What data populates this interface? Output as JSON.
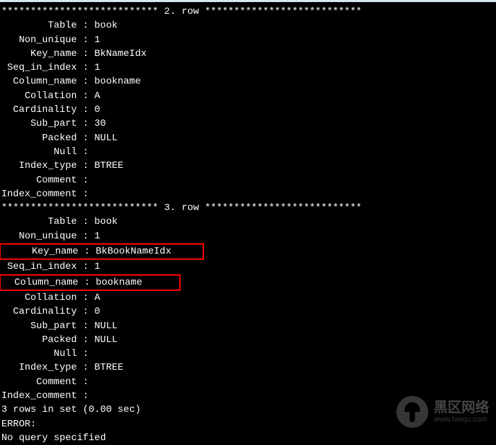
{
  "row2_header": "*************************** 2. row ***************************",
  "row3_header": "*************************** 3. row ***************************",
  "row2": {
    "Table": "book",
    "Non_unique": "1",
    "Key_name": "BkNameIdx",
    "Seq_in_index": "1",
    "Column_name": "bookname",
    "Collation": "A",
    "Cardinality": "0",
    "Sub_part": "30",
    "Packed": "NULL",
    "Null": "",
    "Index_type": "BTREE",
    "Comment": "",
    "Index_comment": ""
  },
  "row3": {
    "Table": "book",
    "Non_unique": "1",
    "Key_name": "BkBookNameIdx",
    "Seq_in_index": "1",
    "Column_name": "bookname",
    "Collation": "A",
    "Cardinality": "0",
    "Sub_part": "NULL",
    "Packed": "NULL",
    "Null": "",
    "Index_type": "BTREE",
    "Comment": "",
    "Index_comment": ""
  },
  "labels": {
    "Table": "Table",
    "Non_unique": "Non_unique",
    "Key_name": "Key_name",
    "Seq_in_index": "Seq_in_index",
    "Column_name": "Column_name",
    "Collation": "Collation",
    "Cardinality": "Cardinality",
    "Sub_part": "Sub_part",
    "Packed": "Packed",
    "Null": "Null",
    "Index_type": "Index_type",
    "Comment": "Comment",
    "Index_comment": "Index_comment"
  },
  "status": "3 rows in set (0.00 sec)",
  "blank": "",
  "error_label": "ERROR:",
  "partial_line": "No query specified",
  "watermark": {
    "cn": "黑区网络",
    "url": "www.heiqu.com"
  }
}
